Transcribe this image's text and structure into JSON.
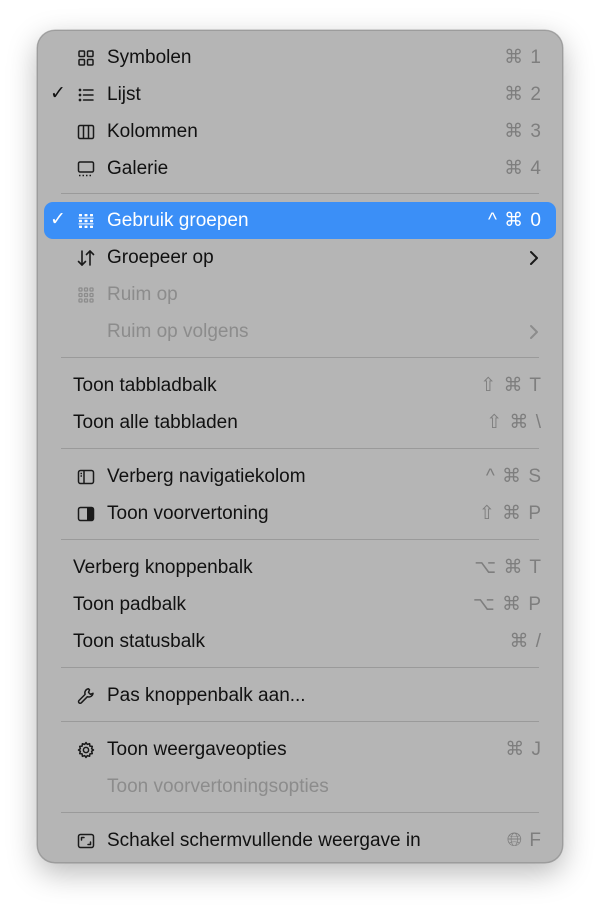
{
  "menu": {
    "symbolen": {
      "label": "Symbolen",
      "shortcut": "⌘ 1",
      "icon": "grid-icon"
    },
    "lijst": {
      "label": "Lijst",
      "shortcut": "⌘ 2",
      "icon": "list-icon",
      "check": "✓"
    },
    "kolommen": {
      "label": "Kolommen",
      "shortcut": "⌘ 3",
      "icon": "columns-icon"
    },
    "galerie": {
      "label": "Galerie",
      "shortcut": "⌘ 4",
      "icon": "gallery-icon"
    },
    "gebruik_groepen": {
      "label": "Gebruik groepen",
      "shortcut": "^ ⌘ 0",
      "icon": "groups-icon",
      "check": "✓"
    },
    "groepeer_op": {
      "label": "Groepeer op",
      "icon": "sort-arrows-icon"
    },
    "ruim_op": {
      "label": "Ruim op",
      "icon": "tidy-grid-icon"
    },
    "ruim_op_volgens": {
      "label": "Ruim op volgens"
    },
    "toon_tabbladbalk": {
      "label": "Toon tabbladbalk",
      "shortcut": "⇧ ⌘ T"
    },
    "toon_alle_tabbladen": {
      "label": "Toon alle tabbladen",
      "shortcut": "⇧ ⌘ \\"
    },
    "verberg_navigatiekolom": {
      "label": "Verberg navigatiekolom",
      "shortcut": "^ ⌘ S",
      "icon": "sidebar-icon"
    },
    "toon_voorvertoning": {
      "label": "Toon voorvertoning",
      "shortcut": "⇧ ⌘ P",
      "icon": "preview-pane-icon"
    },
    "verberg_knoppenbalk": {
      "label": "Verberg knoppenbalk",
      "shortcut": "⌥ ⌘ T"
    },
    "toon_padbalk": {
      "label": "Toon padbalk",
      "shortcut": "⌥ ⌘ P"
    },
    "toon_statusbalk": {
      "label": "Toon statusbalk",
      "shortcut": "⌘ /"
    },
    "pas_knoppenbalk_aan": {
      "label": "Pas knoppenbalk aan...",
      "icon": "wrench-icon"
    },
    "toon_weergaveopties": {
      "label": "Toon weergaveopties",
      "shortcut": "⌘ J",
      "icon": "gear-icon"
    },
    "toon_voorvertoningsopties": {
      "label": "Toon voorvertoningsopties"
    },
    "schermvullend": {
      "label": "Schakel schermvullende weergave in",
      "shortcut": "🌐︎ F",
      "icon": "fullscreen-icon"
    }
  },
  "colors": {
    "menu_background": "#b5b5b5",
    "highlight": "#3b8ff7",
    "text": "#111111",
    "disabled_text": "#8c8c8c",
    "shortcut_text": "#7e7e7e"
  }
}
